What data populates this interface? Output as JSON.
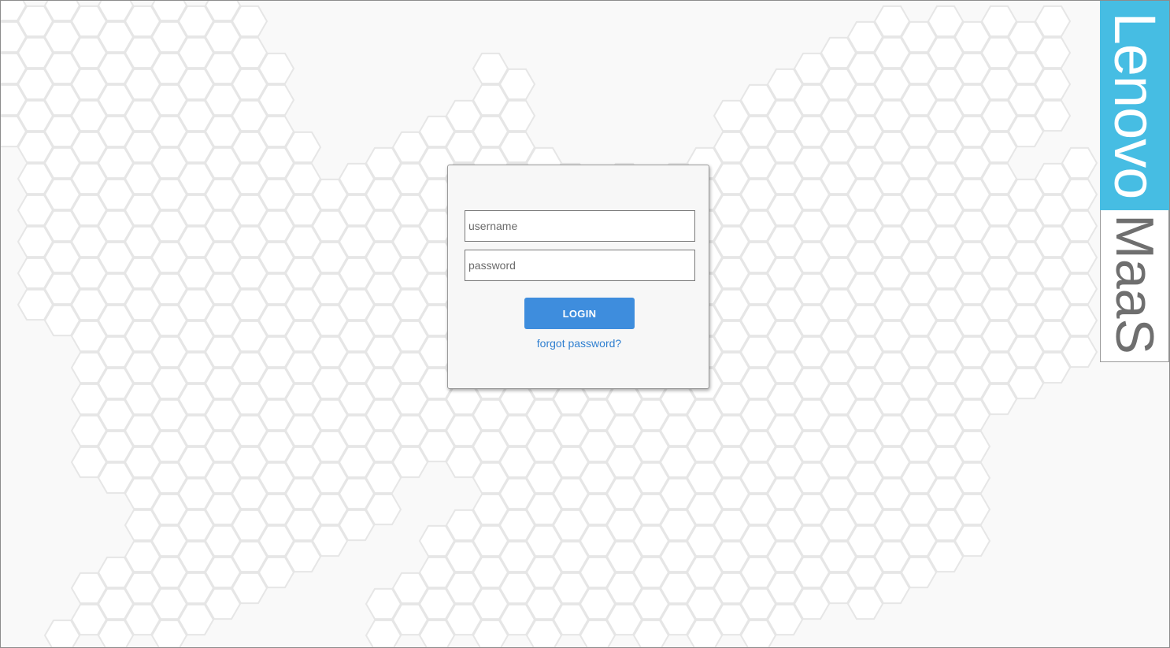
{
  "login": {
    "username_placeholder": "username",
    "password_placeholder": "password",
    "login_label": "LOGIN",
    "forgot_label": "forgot password?"
  },
  "branding": {
    "lenovo": "Lenovo",
    "maas": "MaaS",
    "lenovo_color": "#46bde3"
  },
  "colors": {
    "button": "#3e8ddd",
    "link": "#2f7fd0",
    "background": "#f9f9f9"
  }
}
